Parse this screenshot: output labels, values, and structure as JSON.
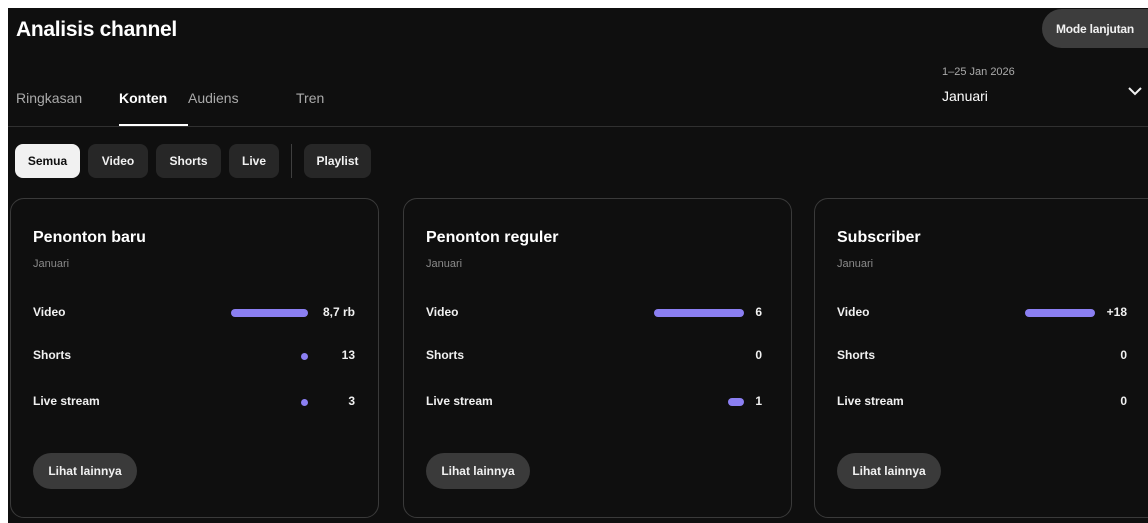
{
  "header": {
    "title": "Analisis channel",
    "mode_button": "Mode lanjutan"
  },
  "tabs": [
    {
      "label": "Ringkasan",
      "active": false
    },
    {
      "label": "Konten",
      "active": true
    },
    {
      "label": "Audiens",
      "active": false
    },
    {
      "label": "Tren",
      "active": false
    }
  ],
  "date_range": {
    "range": "1–25 Jan 2026",
    "period": "Januari",
    "icon": "chevron-down-icon"
  },
  "filters": {
    "chips": [
      "Semua",
      "Video",
      "Shorts",
      "Live"
    ],
    "active": "Semua",
    "playlist": "Playlist"
  },
  "cards": [
    {
      "title": "Penonton baru",
      "period": "Januari",
      "rows": [
        {
          "label": "Video",
          "value": "8,7 rb",
          "level": 1.0
        },
        {
          "label": "Shorts",
          "value": "13",
          "level": 0.01
        },
        {
          "label": "Live stream",
          "value": "3",
          "level": 0.003
        }
      ],
      "button": "Lihat lainnya"
    },
    {
      "title": "Penonton reguler",
      "period": "Januari",
      "rows": [
        {
          "label": "Video",
          "value": "6",
          "level": 1.0
        },
        {
          "label": "Shorts",
          "value": "0",
          "level": 0
        },
        {
          "label": "Live stream",
          "value": "1",
          "level": 0.17
        }
      ],
      "button": "Lihat lainnya"
    },
    {
      "title": "Subscriber",
      "period": "Januari",
      "rows": [
        {
          "label": "Video",
          "value": "+18",
          "level": 1.0
        },
        {
          "label": "Shorts",
          "value": "0",
          "level": 0
        },
        {
          "label": "Live stream",
          "value": "0",
          "level": 0
        }
      ],
      "button": "Lihat lainnya"
    }
  ],
  "colors": {
    "background": "#0f0f0f",
    "bar": "#8b7ff2",
    "card_border": "#3a3a3a"
  }
}
